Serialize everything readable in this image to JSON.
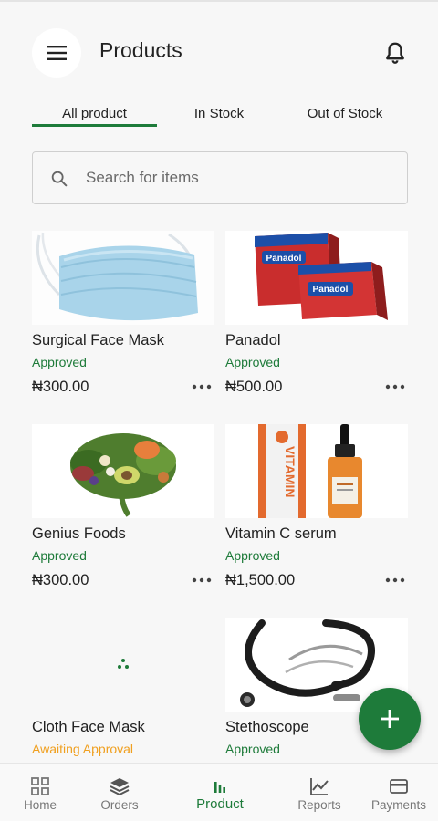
{
  "header": {
    "title": "Products",
    "menu_icon": "hamburger-icon",
    "notification_icon": "bell-icon"
  },
  "tabs": [
    {
      "label": "All product",
      "active": true
    },
    {
      "label": "In Stock",
      "active": false
    },
    {
      "label": "Out of Stock",
      "active": false
    }
  ],
  "search": {
    "placeholder": "Search for items",
    "value": ""
  },
  "products": [
    {
      "name": "Surgical Face Mask",
      "status": "Approved",
      "price": "₦300.00"
    },
    {
      "name": "Panadol",
      "status": "Approved",
      "price": "₦500.00"
    },
    {
      "name": "Genius Foods",
      "status": "Approved",
      "price": "₦300.00"
    },
    {
      "name": "Vitamin C serum",
      "status": "Approved",
      "price": "₦1,500.00"
    },
    {
      "name": "Cloth Face Mask",
      "status": "Awaiting Approval",
      "price": ""
    },
    {
      "name": "Stethoscope",
      "status": "Approved",
      "price": ""
    }
  ],
  "product_image_text": {
    "panadol": "Panadol",
    "vitamin": "VITAMIN"
  },
  "bottom_nav": [
    {
      "label": "Home",
      "icon": "grid-icon",
      "active": false
    },
    {
      "label": "Orders",
      "icon": "layers-icon",
      "active": false
    },
    {
      "label": "Product",
      "icon": "bar-chart-icon",
      "active": true
    },
    {
      "label": "Reports",
      "icon": "line-chart-icon",
      "active": false
    },
    {
      "label": "Payments",
      "icon": "card-icon",
      "active": false
    }
  ],
  "colors": {
    "accent": "#1e7b3a",
    "pending": "#f0a020",
    "background": "#f7f7f7"
  }
}
